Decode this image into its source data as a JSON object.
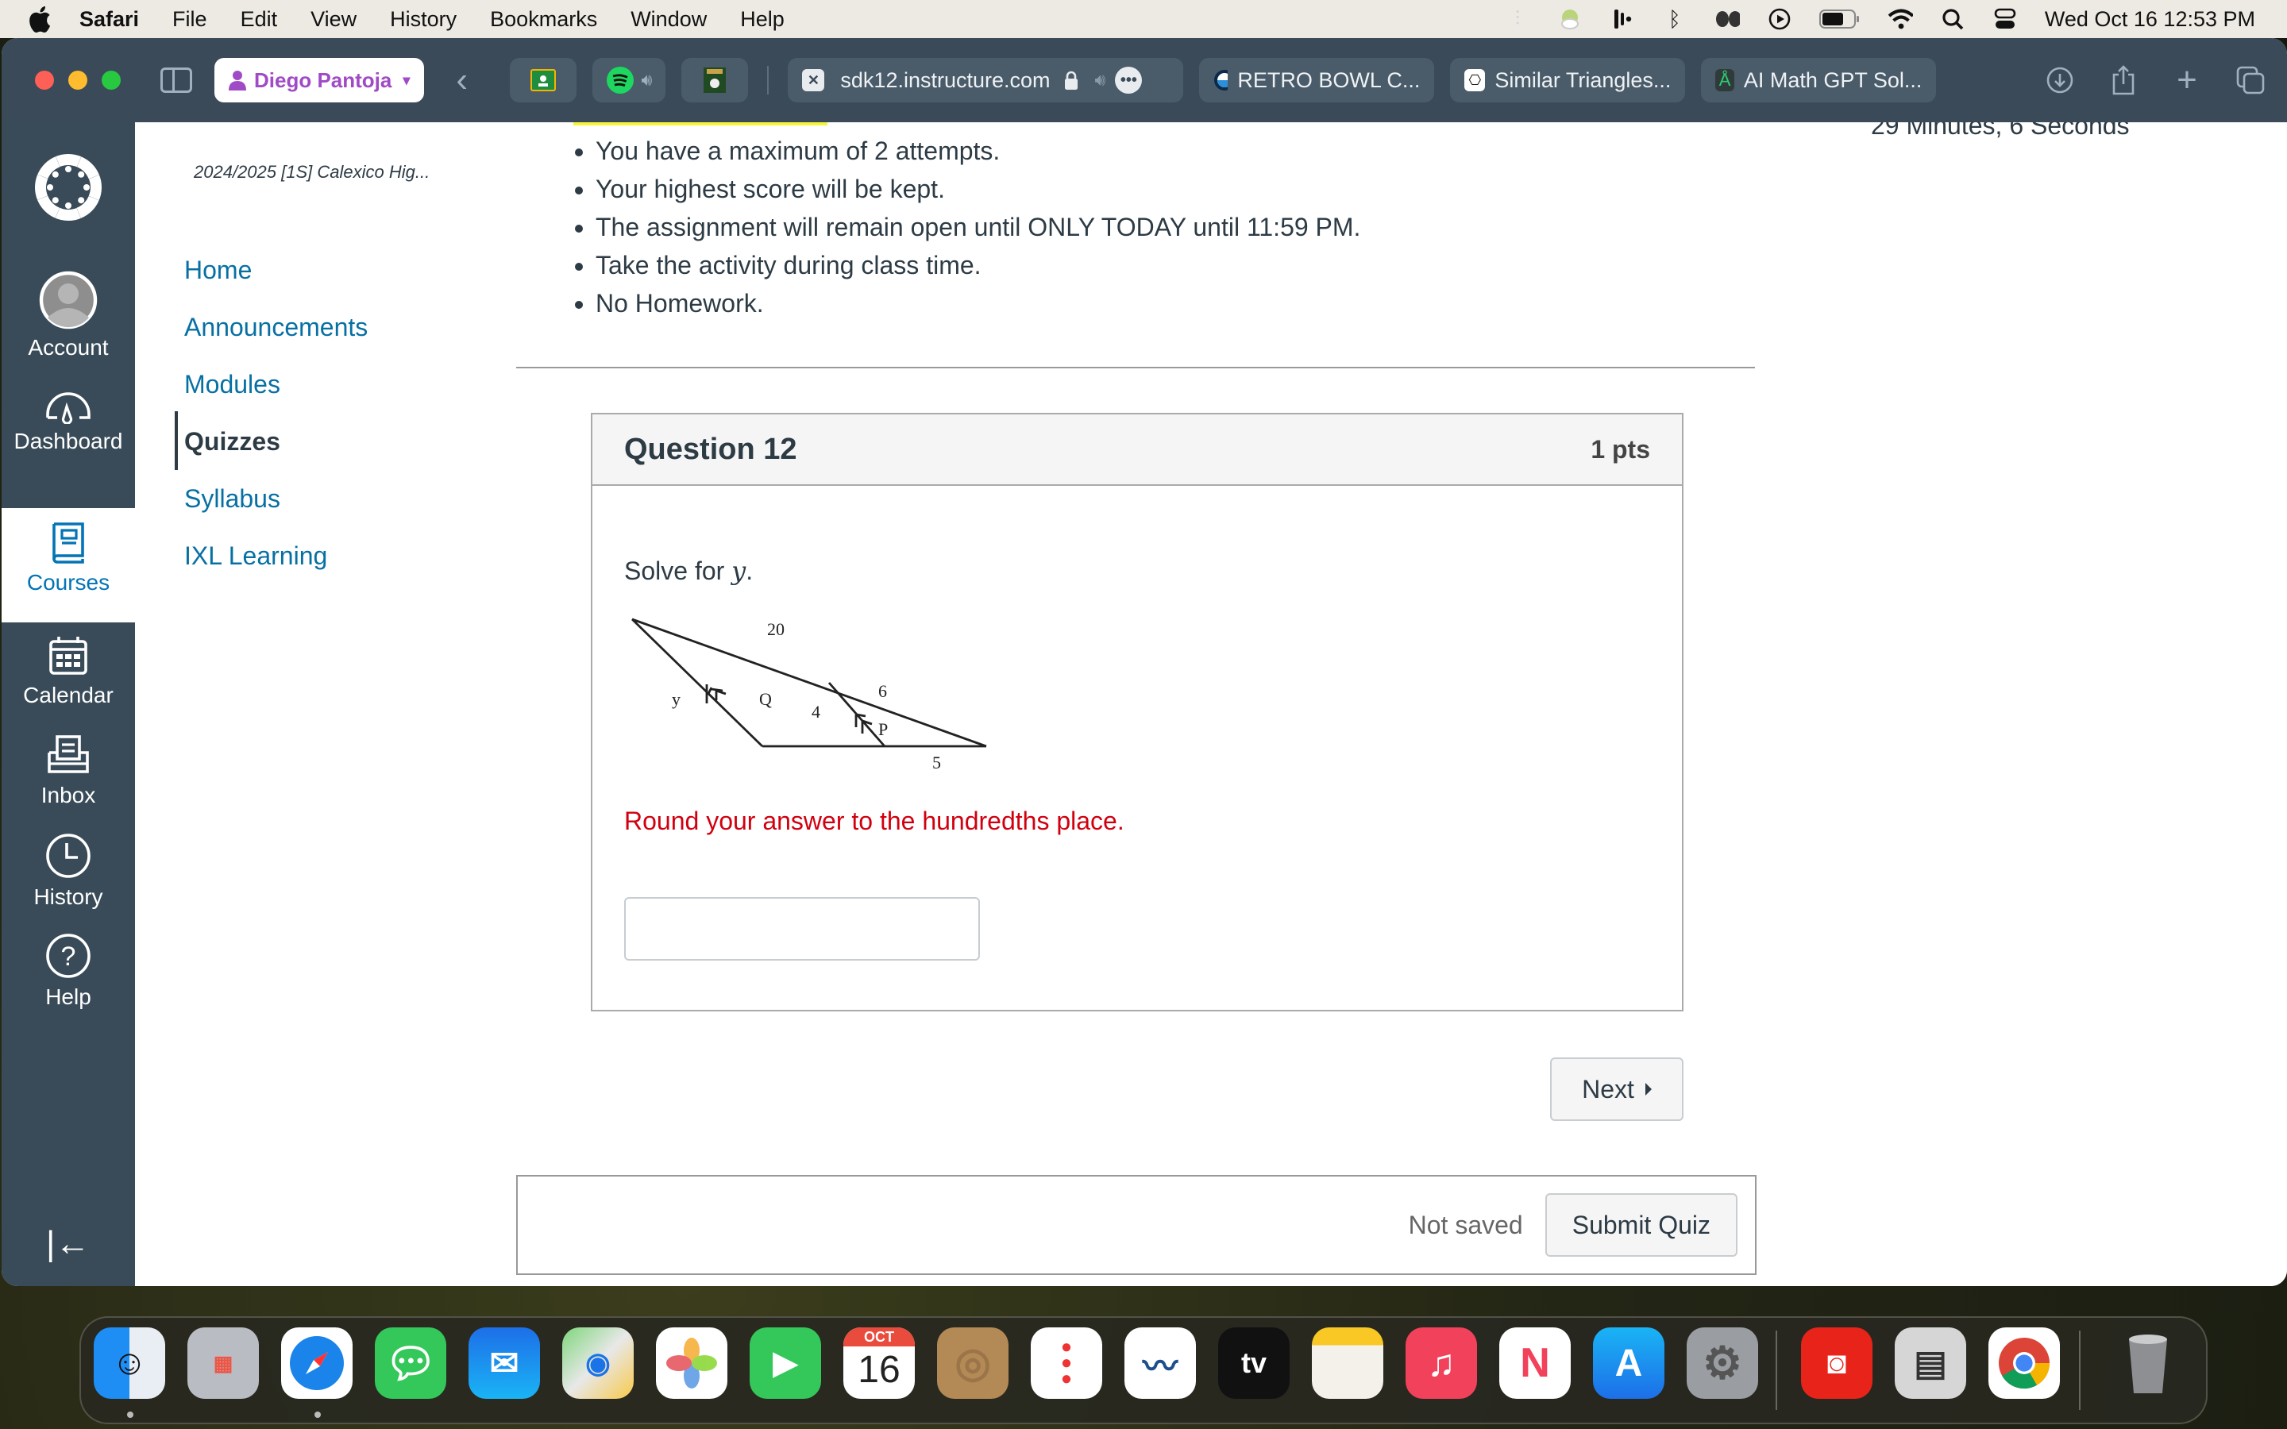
{
  "menubar": {
    "app_name": "Safari",
    "items": [
      "File",
      "Edit",
      "View",
      "History",
      "Bookmarks",
      "Window",
      "Help"
    ],
    "status_icons": [
      "audio-meter-icon",
      "weather-icon",
      "podcast-icon",
      "bluetooth-icon",
      "airpods-icon",
      "play-icon",
      "battery-icon",
      "wifi-icon",
      "spotlight-search-icon",
      "control-center-icon"
    ],
    "clock": "Wed Oct 16  12:53 PM"
  },
  "browser": {
    "profile_name": "Diego Pantoja",
    "pinned_tabs": [
      {
        "icon": "google-classroom-icon"
      },
      {
        "icon": "spotify-icon",
        "audio": true
      },
      {
        "icon": "billiards-game-icon"
      }
    ],
    "tabs": [
      {
        "title": "sdk12.instructure.com",
        "active": true,
        "icon": "close-tab-icon"
      },
      {
        "title": "RETRO BOWL C...",
        "icon": "retro-bowl-icon"
      },
      {
        "title": "Similar Triangles...",
        "icon": "chatgpt-icon"
      },
      {
        "title": "AI Math GPT Sol...",
        "icon": "ai-math-gpt-icon"
      }
    ]
  },
  "global_nav": {
    "items": [
      {
        "label": "Account",
        "icon": "account-avatar-icon"
      },
      {
        "label": "Dashboard",
        "icon": "dashboard-icon"
      },
      {
        "label": "Courses",
        "icon": "courses-icon",
        "active": true
      },
      {
        "label": "Calendar",
        "icon": "calendar-icon"
      },
      {
        "label": "Inbox",
        "icon": "inbox-icon"
      },
      {
        "label": "History",
        "icon": "history-icon"
      },
      {
        "label": "Help",
        "icon": "help-icon"
      }
    ]
  },
  "course_nav": {
    "course_title": "2024/2025 [1S] Calexico Hig...",
    "links": [
      {
        "label": "Home"
      },
      {
        "label": "Announcements"
      },
      {
        "label": "Modules"
      },
      {
        "label": "Quizzes",
        "active": true
      },
      {
        "label": "Syllabus"
      },
      {
        "label": "IXL Learning"
      }
    ]
  },
  "quiz": {
    "instructions": [
      "You have a maximum of 2 attempts.",
      "Your highest score will be kept.",
      "The assignment will remain open until ONLY TODAY until 11:59 PM.",
      "Take the activity during class time.",
      "No Homework."
    ],
    "timer_text": "29 Minutes, 6 Seconds",
    "question": {
      "title": "Question 12",
      "points": "1 pts",
      "prompt": "Solve for ",
      "variable": "y",
      "prompt_end": ".",
      "diagram_labels": {
        "top": "20",
        "right_top": "6",
        "left": "y",
        "inner_left": "Q",
        "inner_mid": "4",
        "inner_right": "P",
        "bottom": "5"
      },
      "hint": "Round your answer to the hundredths place.",
      "answer_value": ""
    },
    "next_label": "Next",
    "save_status": "Not saved",
    "submit_label": "Submit Quiz"
  },
  "dock": {
    "apps": [
      "Finder",
      "Launchpad",
      "Safari",
      "Messages",
      "Mail",
      "Maps",
      "Photos",
      "FaceTime",
      "Calendar",
      "Contacts",
      "Reminders",
      "Freeform",
      "TV",
      "Notes",
      "Music",
      "News",
      "App Store",
      "System Settings",
      "Photo Booth",
      "Calculator",
      "Google Chrome",
      "Trash"
    ],
    "calendar_month": "OCT",
    "calendar_day": "16",
    "tv_label": "tv"
  }
}
